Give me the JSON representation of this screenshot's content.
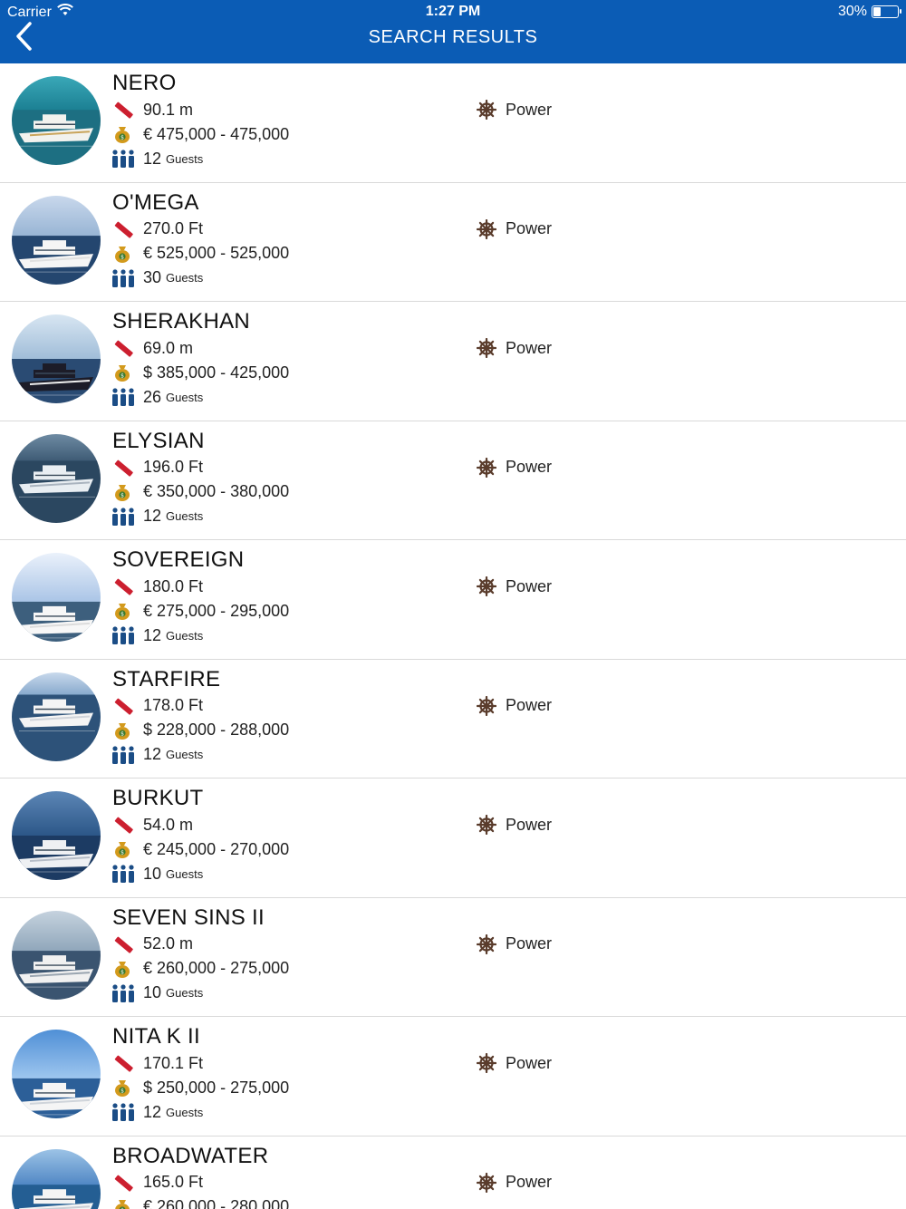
{
  "status_bar": {
    "carrier": "Carrier",
    "time": "1:27 PM",
    "battery": "30%",
    "battery_level": 0.3
  },
  "header": {
    "title": "SEARCH RESULTS",
    "back_icon": "chevron-left-icon"
  },
  "colors": {
    "nav_bg": "#0b5cb5",
    "length_icon": "#cc1f2f",
    "money_icon": "#d39a1c",
    "guests_icon": "#1b4d86",
    "helm_icon": "#5a3c2c"
  },
  "guests_label": "Guests",
  "results": [
    {
      "name": "NERO",
      "length": "90.1 m",
      "price": "€ 475,000 - 475,000",
      "guests": "12",
      "type": "Power"
    },
    {
      "name": "O'MEGA",
      "length": "270.0 Ft",
      "price": "€ 525,000 - 525,000",
      "guests": "30",
      "type": "Power"
    },
    {
      "name": "SHERAKHAN",
      "length": "69.0 m",
      "price": "$ 385,000 - 425,000",
      "guests": "26",
      "type": "Power"
    },
    {
      "name": "ELYSIAN",
      "length": "196.0 Ft",
      "price": "€ 350,000 - 380,000",
      "guests": "12",
      "type": "Power"
    },
    {
      "name": "SOVEREIGN",
      "length": "180.0 Ft",
      "price": "€ 275,000 - 295,000",
      "guests": "12",
      "type": "Power"
    },
    {
      "name": "STARFIRE",
      "length": "178.0 Ft",
      "price": "$ 228,000 - 288,000",
      "guests": "12",
      "type": "Power"
    },
    {
      "name": "BURKUT",
      "length": "54.0 m",
      "price": "€ 245,000 - 270,000",
      "guests": "10",
      "type": "Power"
    },
    {
      "name": "SEVEN SINS II",
      "length": "52.0 m",
      "price": "€ 260,000 - 275,000",
      "guests": "10",
      "type": "Power"
    },
    {
      "name": "NITA K II",
      "length": "170.1 Ft",
      "price": "$ 250,000 - 275,000",
      "guests": "12",
      "type": "Power"
    },
    {
      "name": "BROADWATER",
      "length": "165.0 Ft",
      "price": "€ 260,000 - 280,000",
      "guests": "",
      "type": "Power"
    }
  ]
}
